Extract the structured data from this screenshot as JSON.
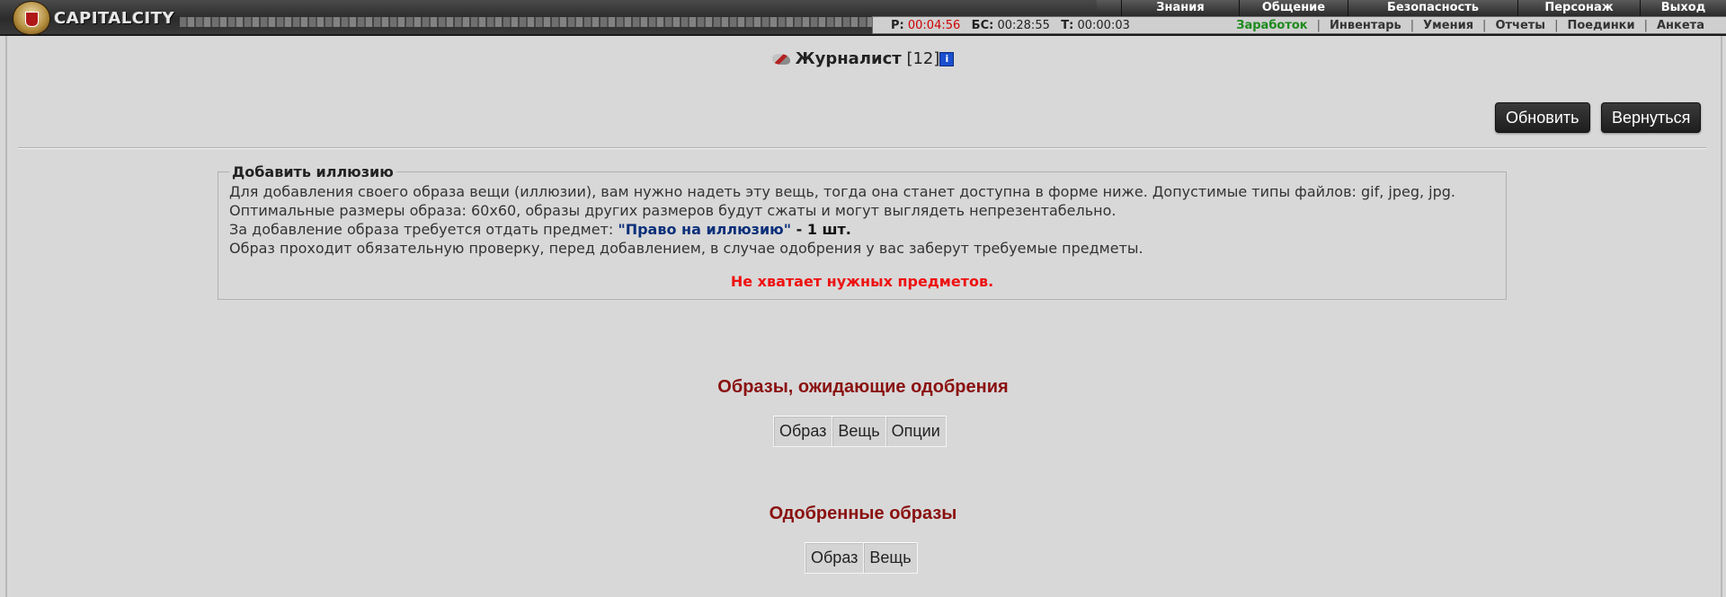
{
  "logo": {
    "text": "CAPITALCITY"
  },
  "topnav": [
    {
      "label": "Знания",
      "width": 130
    },
    {
      "label": "Общение",
      "width": 120
    },
    {
      "label": "Безопасность",
      "width": 188
    },
    {
      "label": "Персонаж",
      "width": 135
    },
    {
      "label": "Выход",
      "width": 95
    }
  ],
  "status": {
    "r_label": "Р:",
    "r_value": "00:04:56",
    "bs_label": "БС:",
    "bs_value": "00:28:55",
    "t_label": "Т:",
    "t_value": "00:00:03"
  },
  "sublinks": [
    "Заработок",
    "Инвентарь",
    "Умения",
    "Отчеты",
    "Поединки",
    "Анкета"
  ],
  "character": {
    "name": "Журналист",
    "level": "[12]",
    "info": "i"
  },
  "buttons": {
    "refresh": "Обновить",
    "back": "Вернуться"
  },
  "illusion": {
    "legend": "Добавить иллюзию",
    "line1": "Для добавления своего образа вещи (иллюзии), вам нужно надеть эту вещь, тогда она станет доступна в форме ниже. Допустимые типы файлов: gif, jpeg, jpg.",
    "line2": "Оптимальные размеры образа: 60x60, образы других размеров будут сжаты и могут выглядеть непрезентабельно.",
    "line3_prefix": "За добавление образа требуется отдать предмет: ",
    "line3_item": "\"Право на иллюзию\"",
    "line3_count": " - 1 шт.",
    "line4": "Образ проходит обязательную проверку, перед добавлением, в случае одобрения у вас заберут требуемые предметы.",
    "warning": "Не хватает нужных предметов."
  },
  "pending": {
    "title": "Образы, ожидающие одобрения",
    "columns": [
      "Образ",
      "Вещь",
      "Опции"
    ]
  },
  "approved": {
    "title": "Одобренные образы",
    "columns": [
      "Образ",
      "Вещь"
    ]
  },
  "colors": {
    "warning": "#ee1111",
    "section_title": "#8a1010",
    "item_link": "#0b2f7a",
    "timer_red": "#d10000",
    "active_link": "#1c8a1c"
  }
}
